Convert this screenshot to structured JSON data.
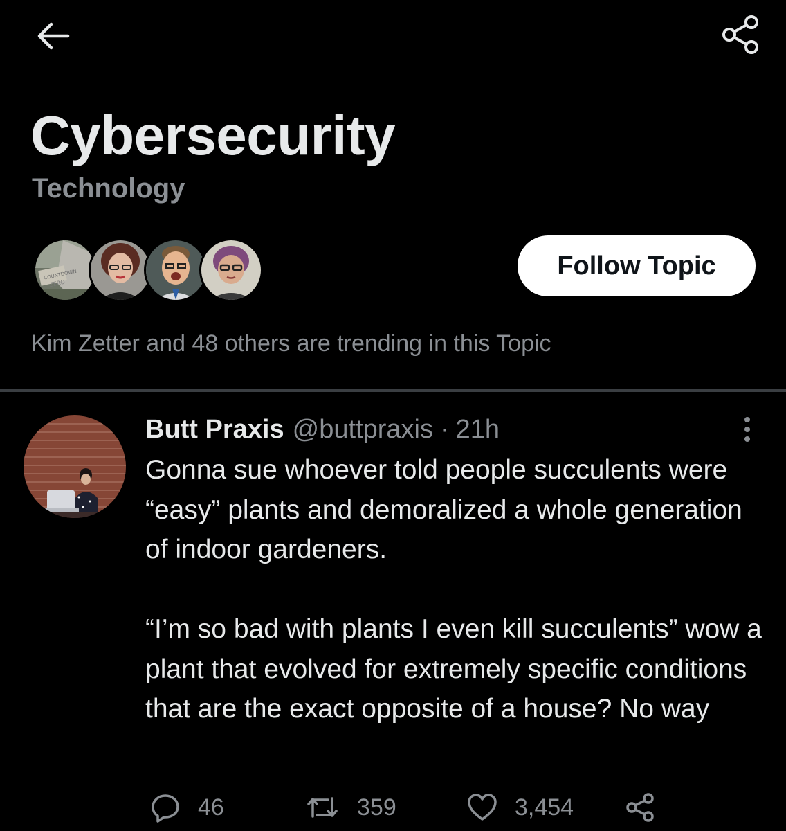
{
  "topbar": {
    "back_icon": "arrow-left-icon",
    "share_icon": "share-icon"
  },
  "topic": {
    "title": "Cybersecurity",
    "category": "Technology",
    "follow_label": "Follow Topic",
    "trending_text": "Kim Zetter and 48 others are trending in this Topic",
    "facepile": [
      "avatar-1",
      "avatar-2",
      "avatar-3",
      "avatar-4"
    ]
  },
  "tweet": {
    "author_name": "Butt Praxis",
    "author_handle": "@buttpraxis",
    "separator": "·",
    "time": "21h",
    "paragraphs": [
      "Gonna sue whoever told people succulents were “easy” plants and demoralized a whole generation of indoor gardeners.",
      "“I’m so bad with plants I even kill succulents” wow a plant that evolved for extremely specific conditions that are the exact opposite of a house? No way"
    ],
    "actions": {
      "reply_count": "46",
      "retweet_count": "359",
      "like_count": "3,454"
    }
  },
  "colors": {
    "background": "#000000",
    "primary_text": "#e7e9ea",
    "secondary_text": "#8b8f94",
    "divider": "#3a3e42",
    "button_bg": "#ffffff"
  }
}
